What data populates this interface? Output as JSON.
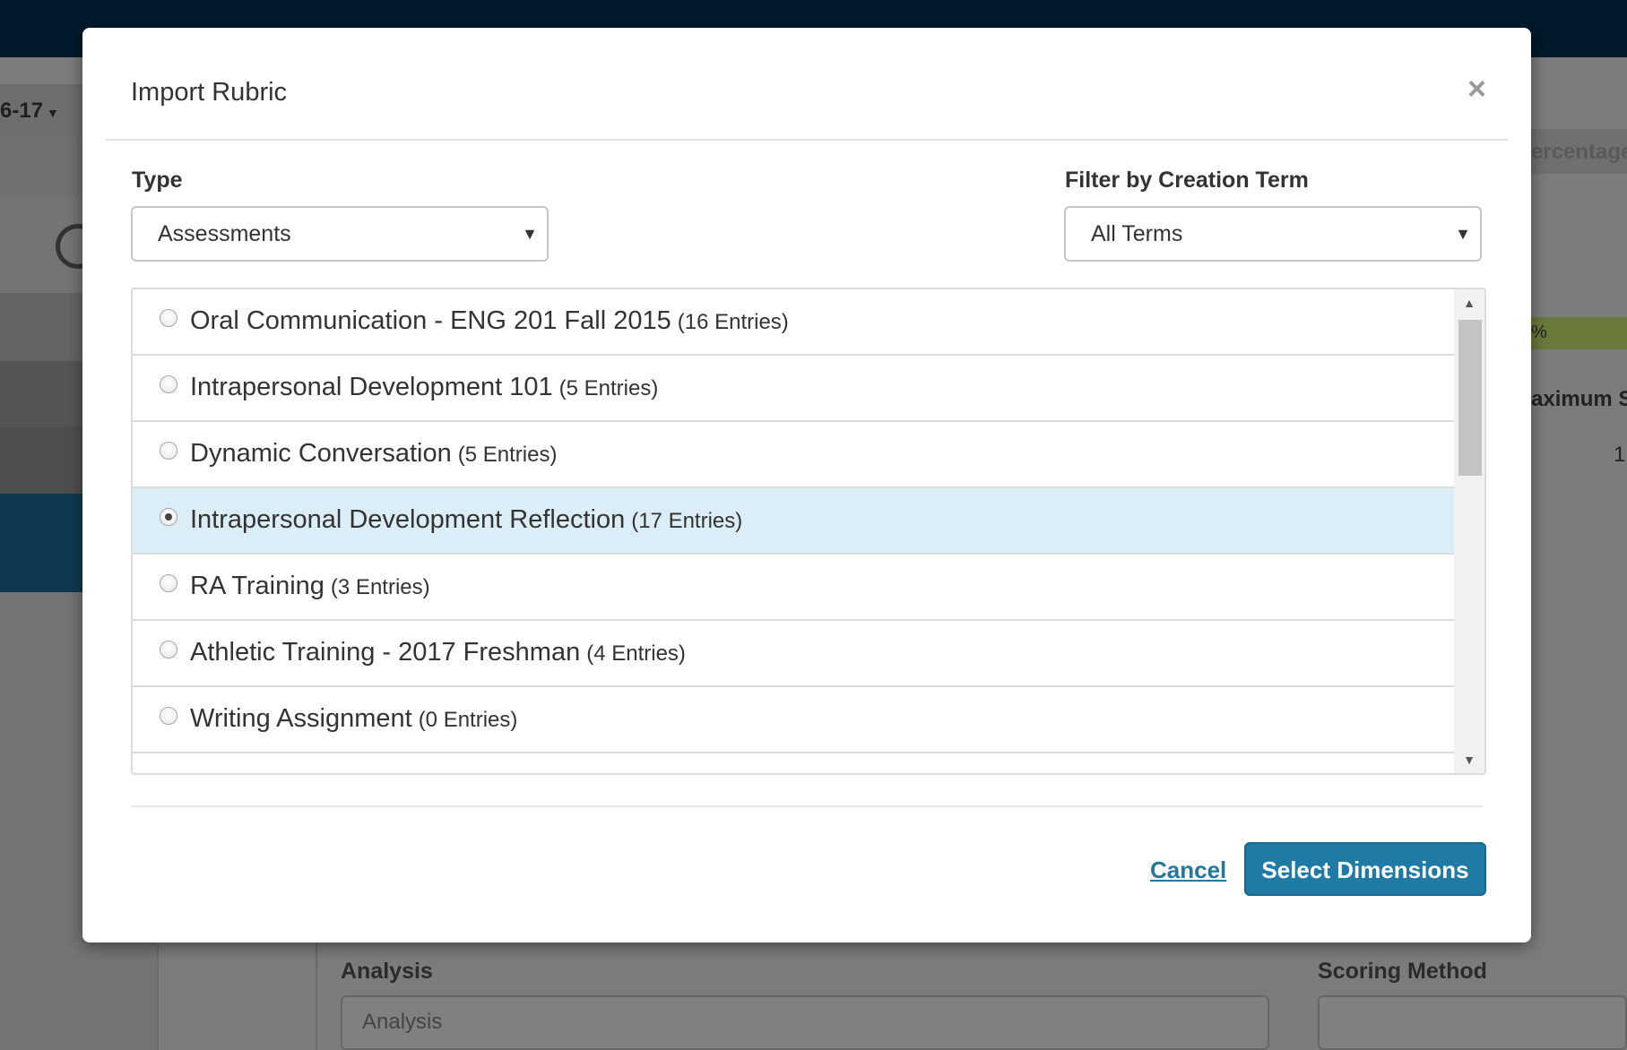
{
  "background": {
    "term_label": "6-17",
    "right_labels": [
      "ercentage",
      "%",
      "aximum S",
      "1"
    ],
    "analysis_label": "Analysis",
    "analysis_placeholder": "Analysis",
    "scoring_method_label": "Scoring Method"
  },
  "modal": {
    "title": "Import Rubric",
    "close_symbol": "×",
    "type_label": "Type",
    "type_value": "Assessments",
    "filter_label": "Filter by Creation Term",
    "filter_value": "All Terms",
    "select_arrow": "▼",
    "items": [
      {
        "name": "Oral Communication - ENG 201 Fall 2015",
        "count": "(16 Entries)",
        "selected": false
      },
      {
        "name": "Intrapersonal Development 101",
        "count": "(5 Entries)",
        "selected": false
      },
      {
        "name": "Dynamic Conversation",
        "count": "(5 Entries)",
        "selected": false
      },
      {
        "name": "Intrapersonal Development Reflection",
        "count": "(17 Entries)",
        "selected": true
      },
      {
        "name": "RA Training",
        "count": "(3 Entries)",
        "selected": false
      },
      {
        "name": "Athletic Training - 2017 Freshman",
        "count": "(4 Entries)",
        "selected": false
      },
      {
        "name": "Writing Assignment",
        "count": "(0 Entries)",
        "selected": false
      }
    ],
    "cancel_label": "Cancel",
    "primary_label": "Select Dimensions"
  }
}
